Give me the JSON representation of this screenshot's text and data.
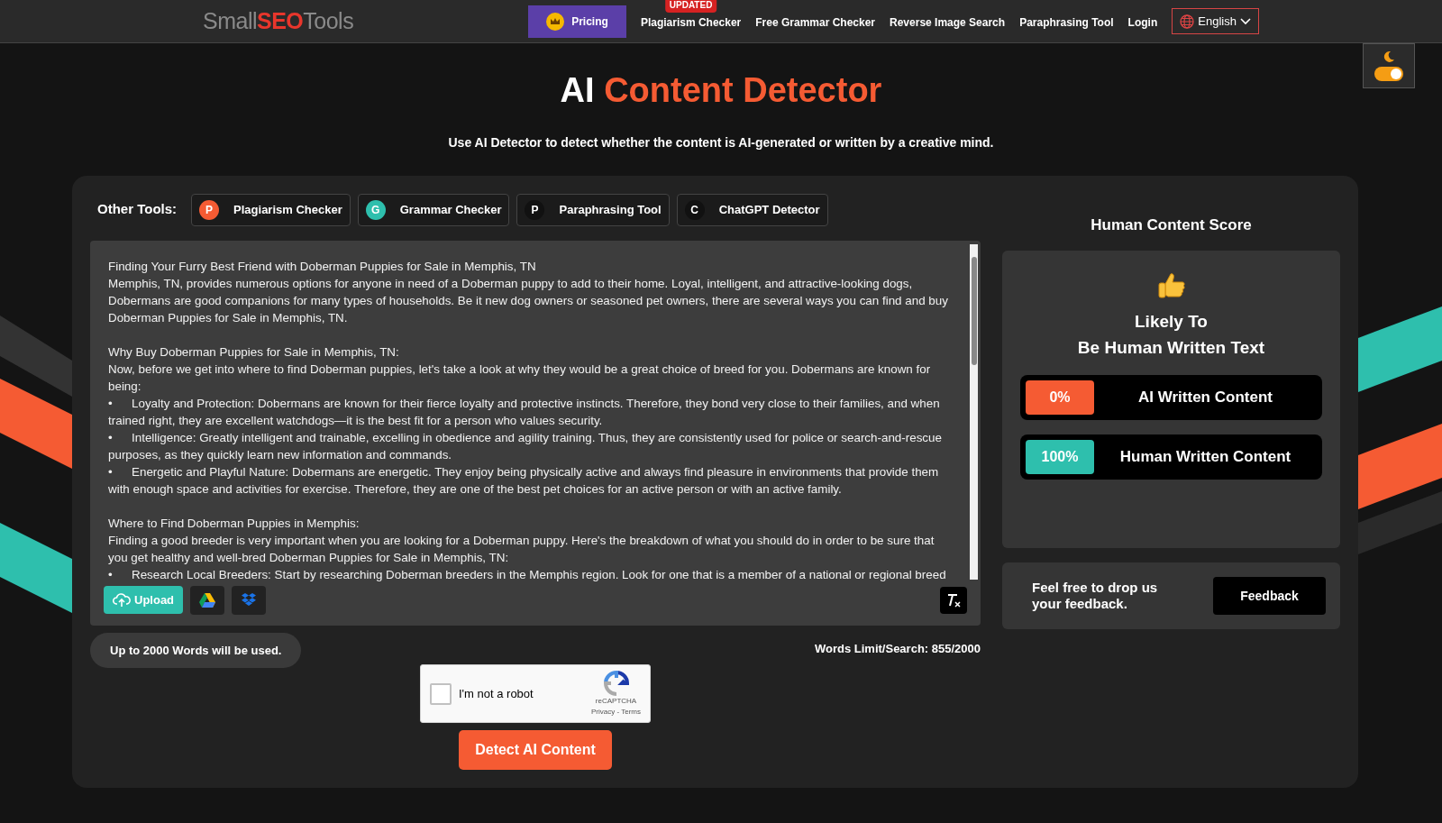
{
  "header": {
    "logo": [
      "Small",
      "SEO",
      "Tools"
    ],
    "pricing": "Pricing",
    "nav": [
      {
        "label": "Plagiarism Checker",
        "badge": "UPDATED"
      },
      {
        "label": "Free Grammar Checker"
      },
      {
        "label": "Reverse Image Search"
      },
      {
        "label": "Paraphrasing Tool"
      },
      {
        "label": "Login"
      }
    ],
    "language": "English"
  },
  "theme_toggle": {
    "on": true
  },
  "hero": {
    "title_plain": "AI",
    "title_accent": "Content Detector",
    "subtitle": "Use AI Detector to detect whether the content is AI-generated or written by a creative mind."
  },
  "other_tools": {
    "label": "Other Tools:",
    "tools": [
      {
        "letter": "P",
        "name": "Plagiarism Checker",
        "color": "#f55b33"
      },
      {
        "letter": "G",
        "name": "Grammar Checker",
        "color": "#2ebfad"
      },
      {
        "letter": "P",
        "name": "Paraphrasing Tool",
        "color": "#111111"
      },
      {
        "letter": "C",
        "name": "ChatGPT Detector",
        "color": "#111111"
      }
    ]
  },
  "editor": {
    "blocks": [
      [
        "Finding Your Furry Best Friend with Doberman Puppies for Sale in Memphis, TN",
        "Memphis, TN, provides numerous options for anyone in need of a Doberman puppy to add to their home. Loyal, intelligent, and attractive-looking dogs, Dobermans are good companions for many types of households. Be it new dog owners or seasoned pet owners, there are several ways you can find and buy Doberman Puppies for Sale in Memphis, TN."
      ],
      [
        "Why Buy Doberman Puppies for Sale in Memphis, TN:",
        "Now, before we get into where to find Doberman puppies, let's take a look at why they would be a great choice of breed for you. Dobermans are known for being:",
        "•\tLoyalty and Protection: Dobermans are known for their fierce loyalty and protective instincts. Therefore, they bond very close to their families, and when trained right, they are excellent watchdogs—it is the best fit for a person who values security.",
        "•\tIntelligence: Greatly intelligent and trainable, excelling in obedience and agility training. Thus, they are consistently used for police or search-and-rescue purposes, as they quickly learn new information and commands.",
        "•\tEnergetic and Playful Nature: Dobermans are energetic. They enjoy being physically active and always find pleasure in environments that provide them with enough space and activities for exercise. Therefore, they are one of the best pet choices for an active person or with an active family."
      ],
      [
        "Where to Find Doberman Puppies in Memphis:",
        "Finding a good breeder is very important when you are looking for a Doberman puppy. Here's the breakdown of what you should do in order to be sure that you get healthy and well-bred Doberman Puppies for Sale in Memphis, TN:",
        "•\tResearch Local Breeders: Start by researching Doberman breeders in the Memphis region. Look for one that is a member of a national or regional breed"
      ]
    ],
    "upload": "Upload",
    "note": "Up to 2000 Words will be used.",
    "word_count": "Words Limit/Search: 855/2000"
  },
  "captcha": {
    "label": "I'm not a robot",
    "checked": false,
    "brand": "reCAPTCHA",
    "links": "Privacy - Terms"
  },
  "detect_button": "Detect AI Content",
  "score": {
    "title": "Human Content Score",
    "verdict_1": "Likely To",
    "verdict_2": "Be Human Written Text",
    "rows": [
      {
        "value": "0%",
        "label": "AI Written Content",
        "color": "#f55b33"
      },
      {
        "value": "100%",
        "label": "Human Written Content",
        "color": "#2ebfad"
      }
    ]
  },
  "feedback": {
    "text": "Feel free to drop us your feedback.",
    "button": "Feedback"
  }
}
